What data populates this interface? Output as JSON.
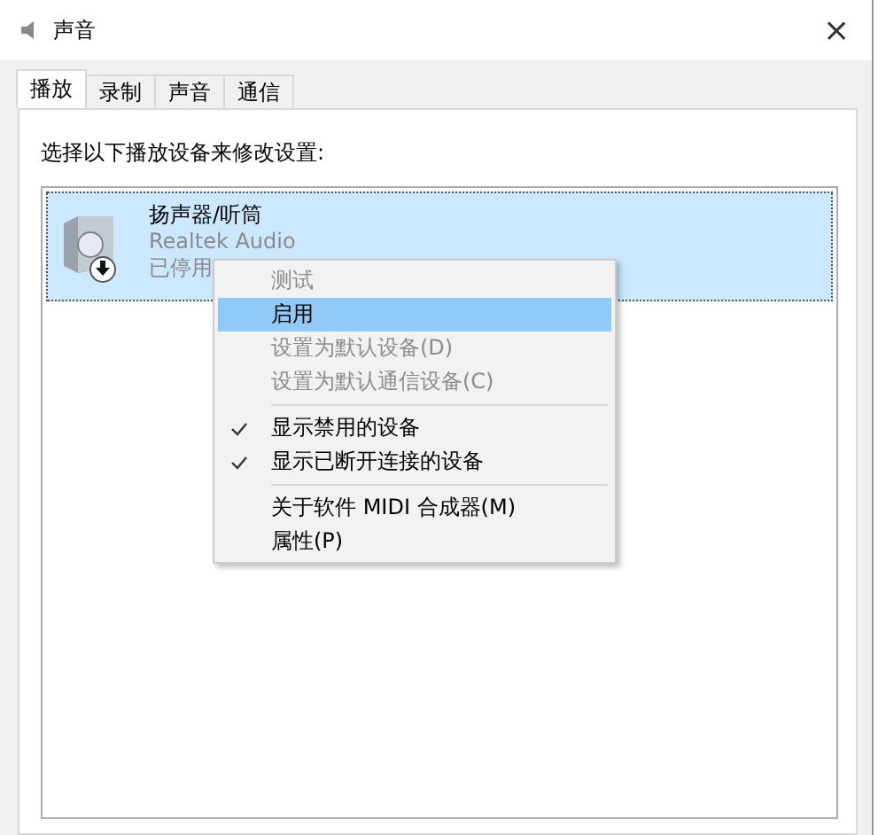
{
  "window": {
    "title": "声音",
    "close": "×"
  },
  "tabs": [
    {
      "label": "播放",
      "selected": true
    },
    {
      "label": "录制",
      "selected": false
    },
    {
      "label": "声音",
      "selected": false
    },
    {
      "label": "通信",
      "selected": false
    }
  ],
  "instruction": "选择以下播放设备来修改设置:",
  "devices": [
    {
      "name": "扬声器/听筒",
      "driver": "Realtek Audio",
      "status": "已停用",
      "selected": true
    }
  ],
  "context_menu": {
    "groups": [
      [
        {
          "label": "测试",
          "disabled": true,
          "selected": false,
          "checked": false
        },
        {
          "label": "启用",
          "disabled": false,
          "selected": true,
          "checked": false
        },
        {
          "label": "设置为默认设备(D)",
          "disabled": true,
          "selected": false,
          "checked": false
        },
        {
          "label": "设置为默认通信设备(C)",
          "disabled": true,
          "selected": false,
          "checked": false
        }
      ],
      [
        {
          "label": "显示禁用的设备",
          "disabled": false,
          "selected": false,
          "checked": true
        },
        {
          "label": "显示已断开连接的设备",
          "disabled": false,
          "selected": false,
          "checked": true
        }
      ],
      [
        {
          "label": "关于软件 MIDI 合成器(M)",
          "disabled": false,
          "selected": false,
          "checked": false
        },
        {
          "label": "属性(P)",
          "disabled": false,
          "selected": false,
          "checked": false
        }
      ]
    ]
  }
}
